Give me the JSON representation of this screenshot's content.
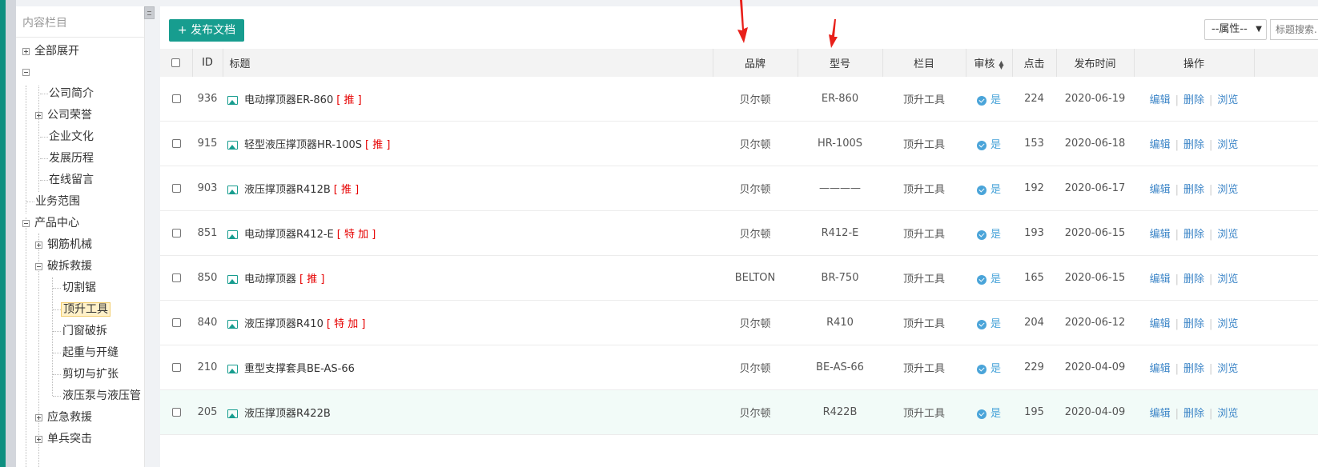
{
  "sidebar": {
    "title": "内容栏目",
    "expand_all": "全部展开",
    "items": [
      {
        "label": "公司简介"
      },
      {
        "label": "公司荣誉"
      },
      {
        "label": "企业文化"
      },
      {
        "label": "发展历程"
      },
      {
        "label": "在线留言"
      },
      {
        "label": "业务范围"
      },
      {
        "label": "产品中心"
      },
      {
        "label": "钢筋机械"
      },
      {
        "label": "破拆救援"
      },
      {
        "label": "切割锯"
      },
      {
        "label": "顶升工具"
      },
      {
        "label": "门窗破拆"
      },
      {
        "label": "起重与开缝"
      },
      {
        "label": "剪切与扩张"
      },
      {
        "label": "液压泵与液压管"
      },
      {
        "label": "应急救援"
      },
      {
        "label": "单兵突击"
      }
    ],
    "selected": "顶升工具"
  },
  "toolbar": {
    "publish_label": "+ 发布文档",
    "attr_select": "--属性--",
    "search_placeholder": "标题搜索..."
  },
  "table": {
    "headers": {
      "id": "ID",
      "title": "标题",
      "brand": "品牌",
      "model": "型号",
      "column": "栏目",
      "audit": "审核",
      "clicks": "点击",
      "date": "发布时间",
      "ops": "操作"
    },
    "rows": [
      {
        "id": "936",
        "title": "电动撑顶器ER-860",
        "tag": "[ 推 ]",
        "brand": "贝尔顿",
        "model": "ER-860",
        "column": "顶升工具",
        "audit": "是",
        "clicks": "224",
        "date": "2020-06-19"
      },
      {
        "id": "915",
        "title": "轻型液压撑顶器HR-100S",
        "tag": "[ 推 ]",
        "brand": "贝尔顿",
        "model": "HR-100S",
        "column": "顶升工具",
        "audit": "是",
        "clicks": "153",
        "date": "2020-06-18"
      },
      {
        "id": "903",
        "title": "液压撑顶器R412B",
        "tag": "[ 推 ]",
        "brand": "贝尔顿",
        "model": "————",
        "column": "顶升工具",
        "audit": "是",
        "clicks": "192",
        "date": "2020-06-17"
      },
      {
        "id": "851",
        "title": "电动撑顶器R412-E",
        "tag": "[ 特 加 ]",
        "brand": "贝尔顿",
        "model": "R412-E",
        "column": "顶升工具",
        "audit": "是",
        "clicks": "193",
        "date": "2020-06-15"
      },
      {
        "id": "850",
        "title": "电动撑顶器",
        "tag": "[ 推 ]",
        "brand": "BELTON",
        "model": "BR-750",
        "column": "顶升工具",
        "audit": "是",
        "clicks": "165",
        "date": "2020-06-15"
      },
      {
        "id": "840",
        "title": "液压撑顶器R410",
        "tag": "[ 特 加 ]",
        "brand": "贝尔顿",
        "model": "R410",
        "column": "顶升工具",
        "audit": "是",
        "clicks": "204",
        "date": "2020-06-12"
      },
      {
        "id": "210",
        "title": "重型支撑套具BE-AS-66",
        "tag": "",
        "brand": "贝尔顿",
        "model": "BE-AS-66",
        "column": "顶升工具",
        "audit": "是",
        "clicks": "229",
        "date": "2020-04-09"
      },
      {
        "id": "205",
        "title": "液压撑顶器R422B",
        "tag": "",
        "brand": "贝尔顿",
        "model": "R422B",
        "column": "顶升工具",
        "audit": "是",
        "clicks": "195",
        "date": "2020-04-09"
      }
    ],
    "ops": {
      "edit": "编辑",
      "delete": "删除",
      "view": "浏览"
    },
    "highlighted_row_index": 7
  },
  "colors": {
    "accent": "#179d8f",
    "link": "#3f87c8",
    "tag_red": "#e60000",
    "arrow_red": "#e8201a"
  }
}
